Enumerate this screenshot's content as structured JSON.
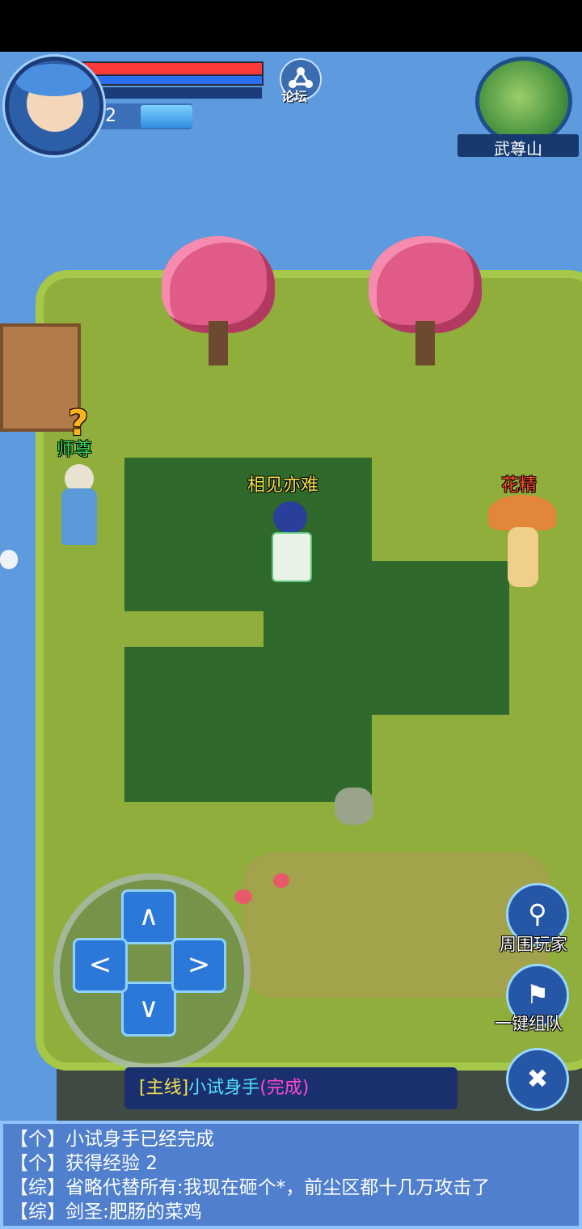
{
  "hud": {
    "level": "2",
    "forum_label": "论坛",
    "map_name": "武尊山"
  },
  "npcs": {
    "master_label": "师尊",
    "player_name": "相见亦难",
    "flower_spirit_label": "花精",
    "quest_marker": "?"
  },
  "buttons": {
    "nearby_players": "周围玩家",
    "one_click_team": "一键组队"
  },
  "quest": {
    "tag": "[主线]",
    "name": "小试身手",
    "status": "(完成)"
  },
  "chat": {
    "lines": [
      "【个】小试身手已经完成",
      "【个】获得经验  2",
      "【综】省略代替所有:我现在砸个*，前尘区都十几万攻击了",
      "【综】剑圣:肥肠的菜鸡"
    ]
  },
  "colors": {
    "player_name": "#f5e24a",
    "master_label": "#3fe05a",
    "flower_label": "#ff4a2a",
    "quest_tag": "#f5e24a",
    "quest_name": "#4fe0ff",
    "quest_status": "#ff4ad0"
  },
  "icons": {
    "dpad_up": "chevron-up-icon",
    "dpad_down": "chevron-down-icon",
    "dpad_left": "chevron-left-icon",
    "dpad_right": "chevron-right-icon",
    "nearby": "location-pin-icon",
    "team": "flag-plus-icon",
    "attack": "crossed-swords-icon"
  }
}
